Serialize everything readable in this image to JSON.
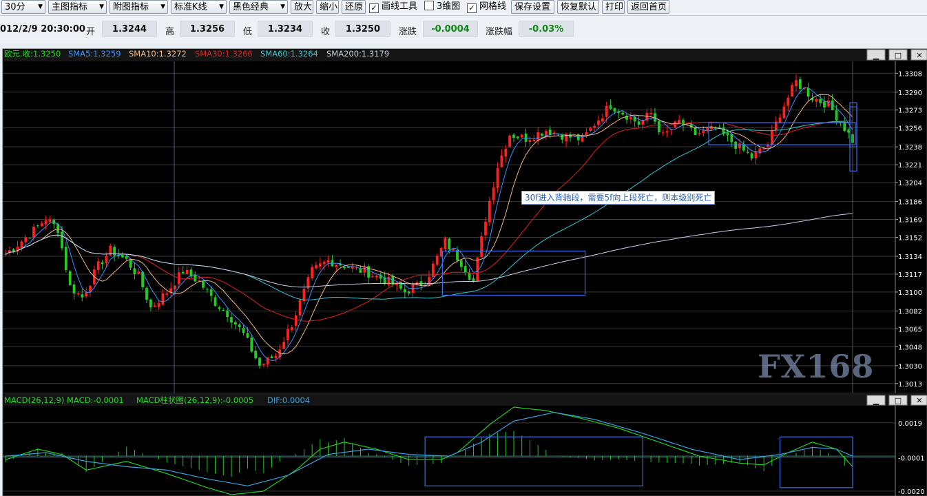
{
  "toolbar": {
    "period": "30分",
    "main_indicator": "主图指标",
    "sub_indicator": "附图指标",
    "kline_type": "标准K线",
    "theme": "黑色经典",
    "zoom_in": "放大",
    "zoom_out": "缩小",
    "restore": "还原",
    "draw_tools": "画线工具",
    "view_3d": "3维图",
    "grid": "网格线",
    "save_settings": "保存设置",
    "restore_defaults": "恢复默认",
    "print": "打印",
    "home": "返回首页",
    "checkboxes": {
      "draw_tools": true,
      "view_3d": false,
      "grid": true
    }
  },
  "quote": {
    "datetime": "012/2/9 20:30:00",
    "open_label": "开",
    "open": "1.3244",
    "high_label": "高",
    "high": "1.3256",
    "low_label": "低",
    "low": "1.3234",
    "close_label": "收",
    "close": "1.3250",
    "change_label": "涨跌",
    "change": "-0.0004",
    "pct_label": "涨跌幅",
    "pct": "-0.03%"
  },
  "main_legend": {
    "close": "欧元.收:1.3250",
    "sma5": "SMA5:1.3259",
    "sma10": "SMA10:1.3272",
    "sma30": "SMA30:1.3266",
    "sma60": "SMA60:1.3264",
    "sma200": "SMA200:1.3179"
  },
  "macd_legend": {
    "macd": "MACD(26,12,9) MACD:-0.0001",
    "hist": "MACD柱状图(26,12,9):-0.0005",
    "dif": "DIF:0.0004"
  },
  "annotation": "30f进入背驰段，需要5f向上段死亡，则本级别死亡",
  "watermark": "FX168",
  "window_buttons": [
    "▁",
    "□",
    "✕"
  ],
  "colors": {
    "background": "#000000",
    "up_candle": "#ff2020",
    "down_candle": "#22cc22",
    "sma5": "#3a8fff",
    "sma10": "#f0b88a",
    "sma30": "#e02020",
    "sma60": "#30c8d8",
    "sma200": "#c8d0e8",
    "macd_line": "#22cc22",
    "signal_line": "#3aa0e0",
    "box": "#3a70e8"
  },
  "chart_data": [
    {
      "type": "candlestick",
      "title": "欧元 30分",
      "y_ticks": [
        "1.3308",
        "1.3290",
        "1.3273",
        "1.3256",
        "1.3238",
        "1.3221",
        "1.3204",
        "1.3186",
        "1.3169",
        "1.3152",
        "1.3134",
        "1.3117",
        "1.3100",
        "1.3082",
        "1.3065",
        "1.3048",
        "1.3030",
        "1.3013"
      ],
      "ylim": [
        1.3005,
        1.3318
      ],
      "close_path": [
        [
          0,
          1.3136
        ],
        [
          6,
          1.3155
        ],
        [
          10,
          1.317
        ],
        [
          13,
          1.316
        ],
        [
          16,
          1.3105
        ],
        [
          19,
          1.3095
        ],
        [
          23,
          1.3125
        ],
        [
          26,
          1.314
        ],
        [
          30,
          1.313
        ],
        [
          33,
          1.3115
        ],
        [
          36,
          1.3085
        ],
        [
          40,
          1.31
        ],
        [
          44,
          1.312
        ],
        [
          48,
          1.311
        ],
        [
          52,
          1.309
        ],
        [
          55,
          1.308
        ],
        [
          59,
          1.306
        ],
        [
          63,
          1.303
        ],
        [
          67,
          1.304
        ],
        [
          71,
          1.307
        ],
        [
          76,
          1.312
        ],
        [
          80,
          1.313
        ],
        [
          85,
          1.3124
        ],
        [
          90,
          1.3118
        ],
        [
          95,
          1.311
        ],
        [
          99,
          1.31
        ],
        [
          104,
          1.311
        ],
        [
          109,
          1.3148
        ],
        [
          113,
          1.3128
        ],
        [
          116,
          1.311
        ],
        [
          119,
          1.317
        ],
        [
          122,
          1.322
        ],
        [
          125,
          1.325
        ],
        [
          129,
          1.3246
        ],
        [
          134,
          1.3254
        ],
        [
          139,
          1.3248
        ],
        [
          143,
          1.3245
        ],
        [
          146,
          1.326
        ],
        [
          150,
          1.3278
        ],
        [
          154,
          1.3268
        ],
        [
          157,
          1.326
        ],
        [
          160,
          1.327
        ],
        [
          163,
          1.3248
        ],
        [
          167,
          1.3262
        ],
        [
          171,
          1.325
        ],
        [
          176,
          1.3255
        ],
        [
          181,
          1.324
        ],
        [
          185,
          1.3228
        ],
        [
          189,
          1.324
        ],
        [
          192,
          1.327
        ],
        [
          196,
          1.33
        ],
        [
          200,
          1.3285
        ],
        [
          204,
          1.3278
        ],
        [
          207,
          1.3262
        ],
        [
          210,
          1.3244
        ]
      ],
      "bars": 211,
      "series": [
        {
          "name": "SMA5",
          "last": 1.3259
        },
        {
          "name": "SMA10",
          "last": 1.3272
        },
        {
          "name": "SMA30",
          "last": 1.3266
        },
        {
          "name": "SMA60",
          "last": 1.3264
        },
        {
          "name": "SMA200",
          "last": 1.3179
        }
      ],
      "grid": true,
      "boxes": [
        {
          "x": [
            109,
            143
          ],
          "y": [
            1.3097,
            1.3139
          ]
        },
        {
          "x": [
            175,
            262
          ],
          "y": [
            1.324,
            1.3261
          ]
        },
        {
          "x": [
            268,
            298
          ],
          "y": [
            1.3238,
            1.328
          ]
        },
        {
          "x": [
            298,
            330
          ],
          "y": [
            1.3215,
            1.3276
          ]
        }
      ]
    },
    {
      "type": "macd",
      "y_ticks": [
        "0.0019",
        "-0.0001",
        "-0.0020"
      ],
      "ylim": [
        -0.0022,
        0.0028
      ],
      "macd_path": [
        [
          0,
          -0.0002
        ],
        [
          8,
          0.0004
        ],
        [
          14,
          0.0001
        ],
        [
          20,
          -0.0008
        ],
        [
          30,
          -0.0003
        ],
        [
          40,
          -0.001
        ],
        [
          50,
          -0.0018
        ],
        [
          56,
          -0.0022
        ],
        [
          64,
          -0.002
        ],
        [
          72,
          -0.0008
        ],
        [
          78,
          0.0004
        ],
        [
          84,
          0.0008
        ],
        [
          92,
          0.0004
        ],
        [
          100,
          -0.0002
        ],
        [
          108,
          -0.0002
        ],
        [
          112,
          0.0002
        ],
        [
          120,
          0.0018
        ],
        [
          126,
          0.0028
        ],
        [
          134,
          0.0026
        ],
        [
          142,
          0.0022
        ],
        [
          152,
          0.0016
        ],
        [
          162,
          0.0008
        ],
        [
          172,
          0.0
        ],
        [
          182,
          -0.0004
        ],
        [
          188,
          -0.0005
        ],
        [
          194,
          0.0002
        ],
        [
          200,
          0.0008
        ],
        [
          206,
          0.0004
        ],
        [
          210,
          -0.0006
        ]
      ],
      "signal_path": [
        [
          0,
          0.0
        ],
        [
          10,
          0.0002
        ],
        [
          20,
          -0.0003
        ],
        [
          30,
          -0.0006
        ],
        [
          40,
          -0.0008
        ],
        [
          50,
          -0.0013
        ],
        [
          60,
          -0.0017
        ],
        [
          70,
          -0.0011
        ],
        [
          80,
          0.0001
        ],
        [
          90,
          0.0004
        ],
        [
          100,
          0.0001
        ],
        [
          110,
          0.0
        ],
        [
          118,
          0.0008
        ],
        [
          126,
          0.002
        ],
        [
          136,
          0.0025
        ],
        [
          146,
          0.0021
        ],
        [
          158,
          0.0013
        ],
        [
          170,
          0.0004
        ],
        [
          182,
          -0.0002
        ],
        [
          192,
          0.0001
        ],
        [
          200,
          0.0005
        ],
        [
          206,
          0.0004
        ],
        [
          210,
          0.0
        ]
      ],
      "boxes": [
        {
          "x": [
            52,
            79
          ],
          "y": [
            -0.0017,
            0.0011
          ]
        },
        {
          "x": [
            96,
            113
          ],
          "y": [
            -0.0018,
            0.0011
          ]
        },
        {
          "x": [
            185,
            198
          ],
          "y": [
            -0.0016,
            0.0006
          ]
        }
      ]
    }
  ]
}
